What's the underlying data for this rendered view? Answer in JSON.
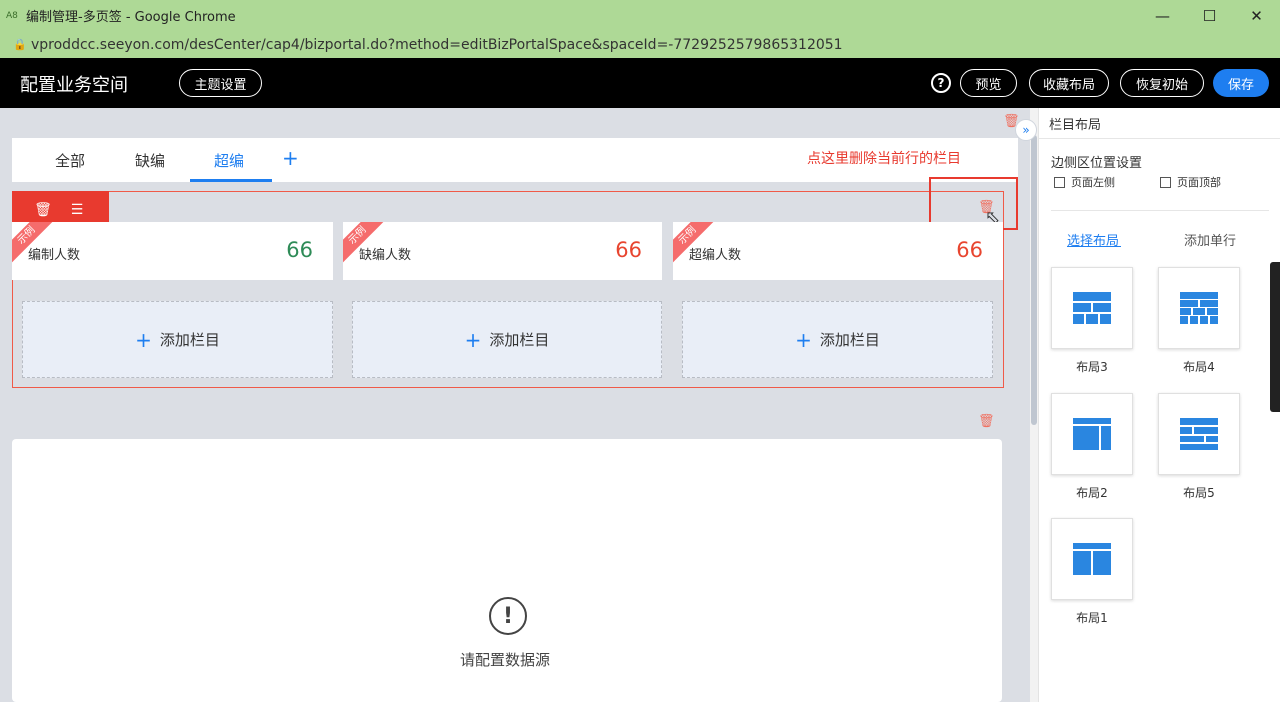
{
  "browser": {
    "title": "编制管理-多页签 - Google Chrome",
    "url": "vproddcc.seeyon.com/desCenter/cap4/bizportal.do?method=editBizPortalSpace&spaceId=-7729252579865312051",
    "logo": "A8"
  },
  "header": {
    "title": "配置业务空间",
    "theme_btn": "主题设置",
    "help": "?",
    "preview": "预览",
    "collect_layout": "收藏布局",
    "restore": "恢复初始",
    "save": "保存"
  },
  "tabs": [
    {
      "label": "全部"
    },
    {
      "label": "缺编"
    },
    {
      "label": "超编"
    }
  ],
  "add_tab": "+",
  "hint": "点这里删除当前行的栏目",
  "cards": [
    {
      "badge": "示例",
      "label": "编制人数",
      "value": "66",
      "color": "#2e8b57"
    },
    {
      "badge": "示例",
      "label": "缺编人数",
      "value": "66",
      "color": "#e8452f"
    },
    {
      "badge": "示例",
      "label": "超编人数",
      "value": "66",
      "color": "#e8452f"
    }
  ],
  "add_column": "添加栏目",
  "empty": {
    "icon": "!",
    "text": "请配置数据源"
  },
  "right_panel": {
    "title": "栏目布局",
    "side_position": "边侧区位置设置",
    "page_left": "页面左侧",
    "page_top": "页面顶部",
    "tab_select": "选择布局",
    "tab_add_row": "添加单行",
    "layouts": [
      "布局3",
      "布局4",
      "布局2",
      "布局5",
      "布局1"
    ]
  },
  "colors": {
    "accent": "#1e7ef0",
    "danger": "#e83a2f",
    "chrome_bar": "#aed996"
  }
}
